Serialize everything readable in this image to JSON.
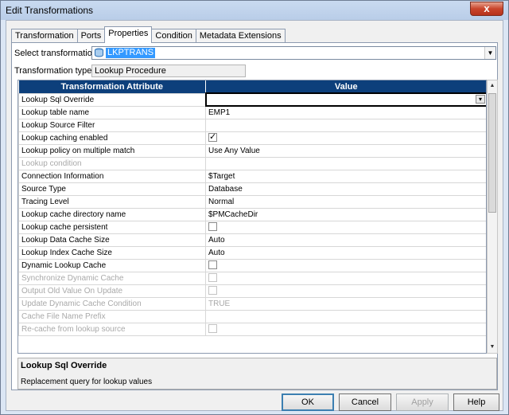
{
  "window": {
    "title": "Edit Transformations",
    "close_glyph": "x"
  },
  "tabs": [
    {
      "label": "Transformation"
    },
    {
      "label": "Ports"
    },
    {
      "label": "Properties"
    },
    {
      "label": "Condition"
    },
    {
      "label": "Metadata Extensions"
    }
  ],
  "select_transformation": {
    "label": "Select transformation:",
    "value": "LKPTRANS"
  },
  "transformation_type": {
    "label": "Transformation type:",
    "value": "Lookup Procedure"
  },
  "grid": {
    "headers": {
      "attribute": "Transformation Attribute",
      "value": "Value"
    },
    "rows": [
      {
        "attr": "Lookup Sql Override",
        "value": "",
        "selected": true
      },
      {
        "attr": "Lookup table name",
        "value": "EMP1"
      },
      {
        "attr": "Lookup Source Filter",
        "value": ""
      },
      {
        "attr": "Lookup caching enabled",
        "checkbox": "checked"
      },
      {
        "attr": "Lookup policy on multiple match",
        "value": "Use Any Value"
      },
      {
        "attr": "Lookup condition",
        "value": "",
        "disabled": true
      },
      {
        "attr": "Connection Information",
        "value": "$Target"
      },
      {
        "attr": "Source Type",
        "value": "Database"
      },
      {
        "attr": "Tracing Level",
        "value": "Normal"
      },
      {
        "attr": "Lookup cache directory name",
        "value": "$PMCacheDir"
      },
      {
        "attr": "Lookup cache persistent",
        "checkbox": "unchecked"
      },
      {
        "attr": "Lookup Data Cache Size",
        "value": "Auto"
      },
      {
        "attr": "Lookup Index Cache Size",
        "value": "Auto"
      },
      {
        "attr": "Dynamic Lookup Cache",
        "checkbox": "unchecked"
      },
      {
        "attr": "Synchronize Dynamic Cache",
        "checkbox": "unchecked",
        "disabled": true
      },
      {
        "attr": "Output Old Value On Update",
        "checkbox": "unchecked",
        "disabled": true
      },
      {
        "attr": "Update Dynamic Cache Condition",
        "value": "TRUE",
        "disabled": true
      },
      {
        "attr": "Cache File Name Prefix",
        "value": "",
        "disabled": true
      },
      {
        "attr": "Re-cache from lookup source",
        "checkbox": "unchecked",
        "disabled": true
      }
    ]
  },
  "description": {
    "title": "Lookup Sql Override",
    "text": "Replacement query for lookup values"
  },
  "buttons": {
    "ok": "OK",
    "cancel": "Cancel",
    "apply": "Apply",
    "help": "Help"
  },
  "icons": {
    "close": "close-icon",
    "dropdown": "chevron-down-icon",
    "database": "database-icon",
    "edit": "edit-icon"
  }
}
